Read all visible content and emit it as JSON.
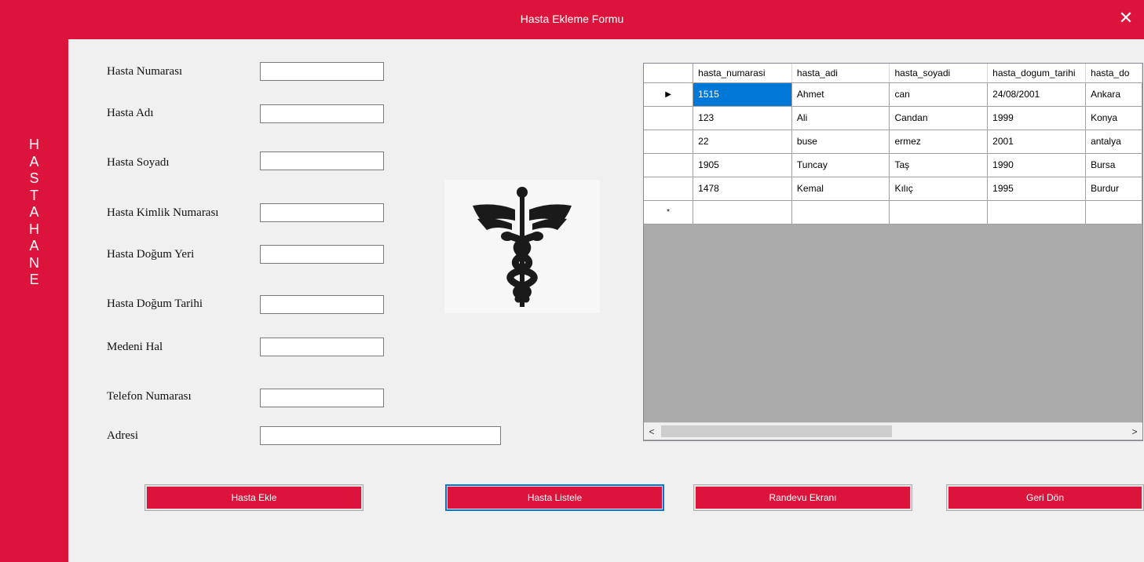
{
  "window": {
    "title": "Hasta Ekleme Formu",
    "close_glyph": "✕"
  },
  "sidebar": {
    "letters": [
      "H",
      "A",
      "S",
      "T",
      "A",
      "H",
      "A",
      "N",
      "E"
    ]
  },
  "form": {
    "fields": [
      {
        "label": "Hasta Numarası",
        "value": ""
      },
      {
        "label": "Hasta Adı",
        "value": ""
      },
      {
        "label": "Hasta Soyadı",
        "value": ""
      },
      {
        "label": "Hasta Kimlik Numarası",
        "value": ""
      },
      {
        "label": "Hasta Doğum Yeri",
        "value": ""
      },
      {
        "label": "Hasta Doğum Tarihi",
        "value": ""
      },
      {
        "label": "Medeni Hal",
        "value": ""
      },
      {
        "label": "Telefon Numarası",
        "value": ""
      },
      {
        "label": "Adresi",
        "value": ""
      }
    ]
  },
  "logo": {
    "icon": "caduceus-icon"
  },
  "grid": {
    "columns": [
      "hasta_numarasi",
      "hasta_adi",
      "hasta_soyadi",
      "hasta_dogum_tarihi",
      "hasta_do"
    ],
    "rows": [
      [
        "1515",
        "Ahmet",
        "can",
        "24/08/2001",
        "Ankara"
      ],
      [
        "123",
        "Ali",
        "Candan",
        "1999",
        "Konya"
      ],
      [
        "22",
        "buse",
        "ermez",
        "2001",
        "antalya"
      ],
      [
        "1905",
        "Tuncay",
        "Taş",
        "1990",
        "Bursa"
      ],
      [
        "1478",
        "Kemal",
        "Kılıç",
        "1995",
        "Burdur"
      ]
    ],
    "current_row_glyph": "▶",
    "new_row_glyph": "*",
    "scroll_left_glyph": "<",
    "scroll_right_glyph": ">"
  },
  "buttons": {
    "add": "Hasta Ekle",
    "list": "Hasta Listele",
    "appointment": "Randevu Ekranı",
    "back": "Geri Dön"
  },
  "colors": {
    "accent": "#dc143c",
    "selection": "#0078d7"
  }
}
